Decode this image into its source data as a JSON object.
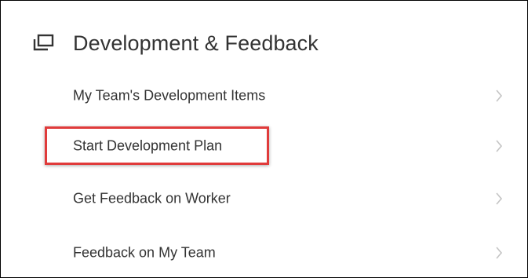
{
  "header": {
    "title": "Development & Feedback",
    "icon": "window-stack-icon"
  },
  "items": [
    {
      "label": "My Team's Development Items",
      "icon": "chevron-right-icon"
    },
    {
      "label": "Start Development Plan",
      "icon": "chevron-right-icon",
      "highlighted": true
    },
    {
      "label": "Get Feedback on Worker",
      "icon": "chevron-right-icon"
    },
    {
      "label": "Feedback on My Team",
      "icon": "chevron-right-icon"
    }
  ],
  "colors": {
    "text": "#333333",
    "chevron": "#c4c4c4",
    "highlight_border": "#e03b3b",
    "frame_border": "#000000"
  }
}
